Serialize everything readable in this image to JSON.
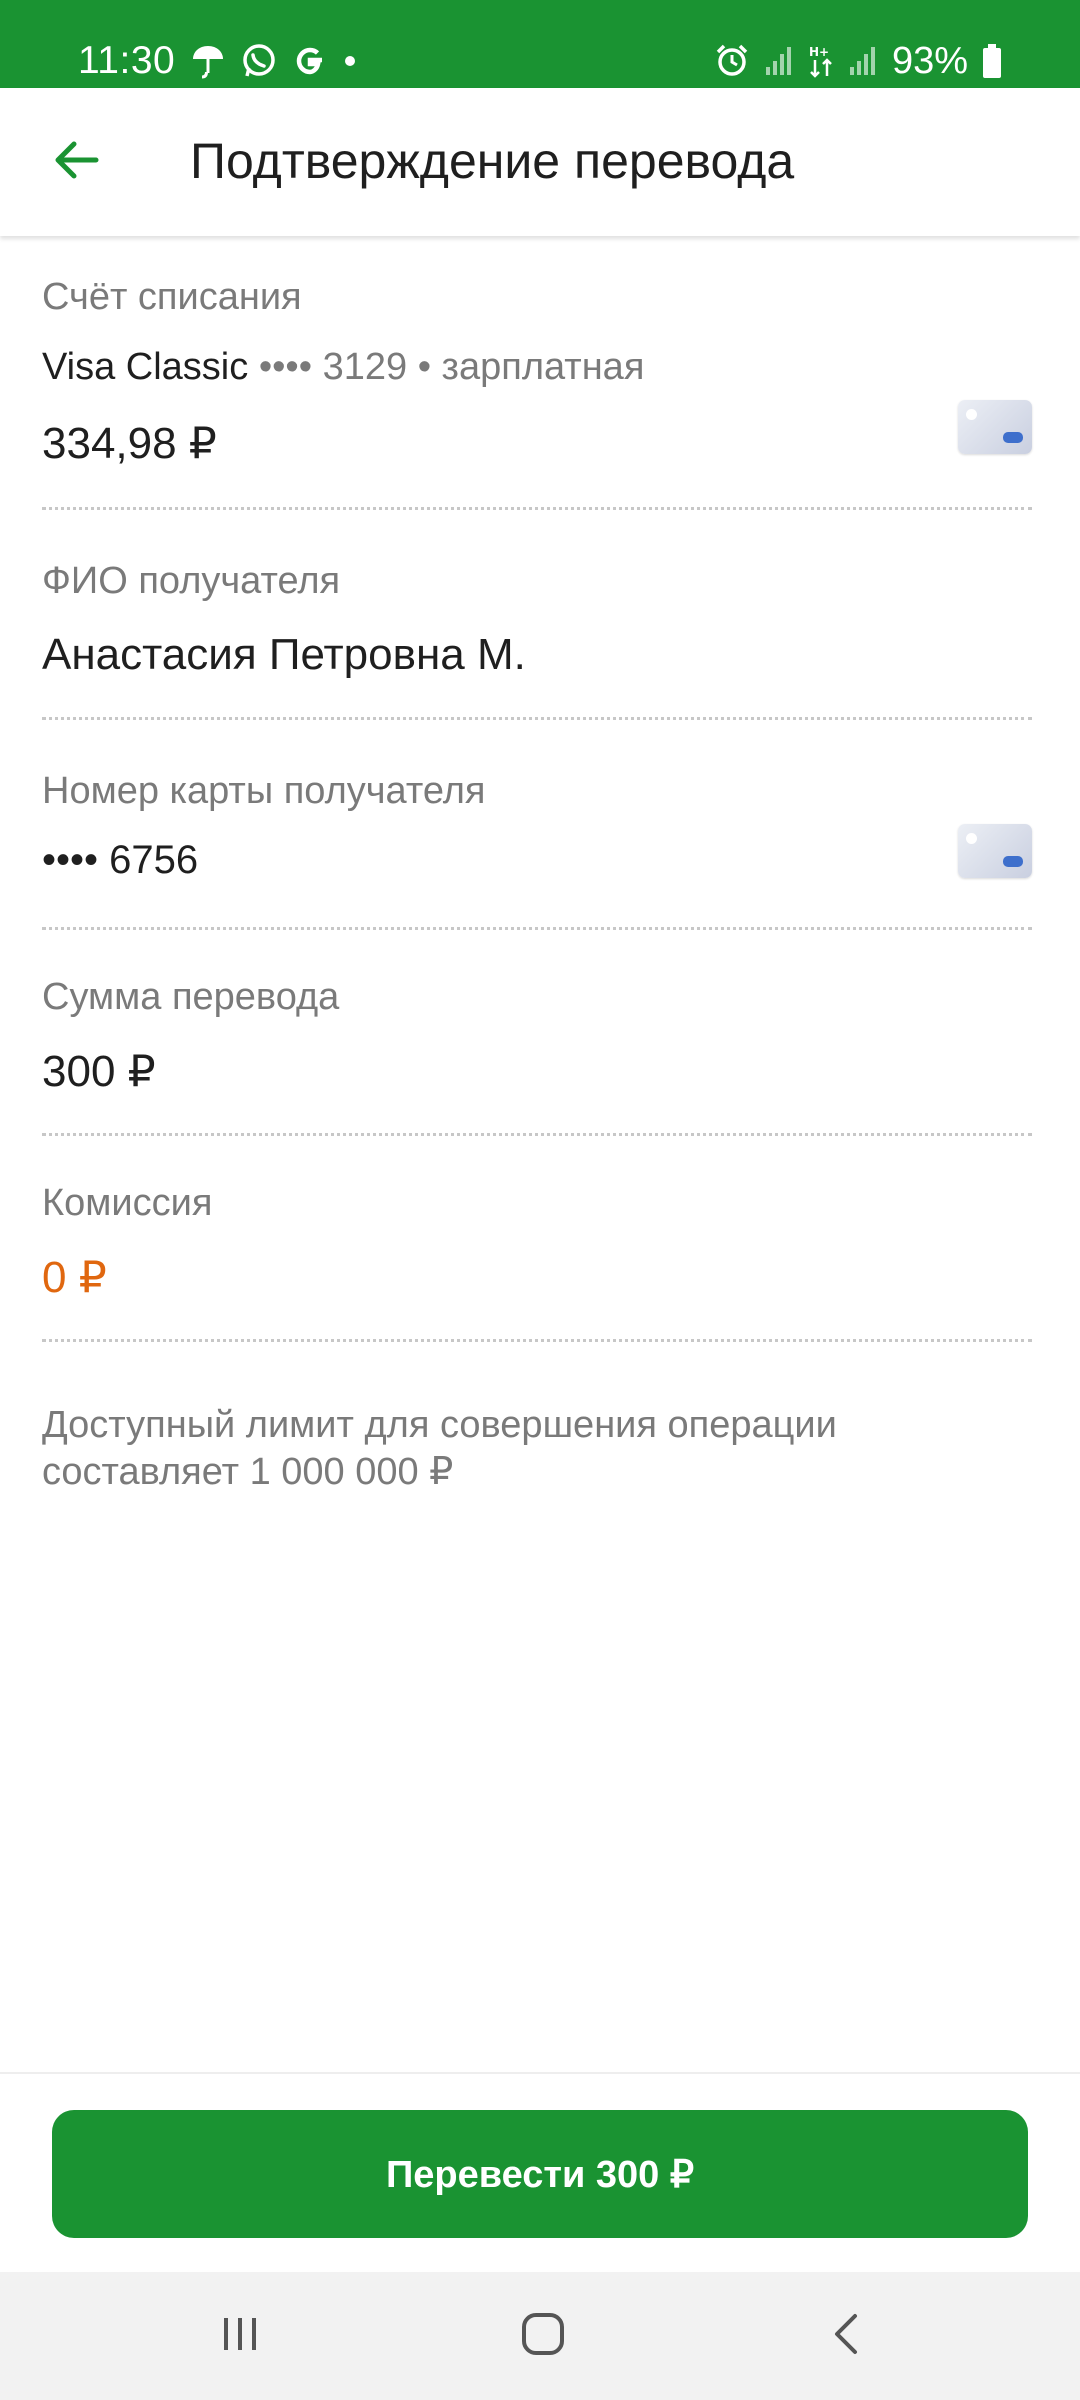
{
  "status_bar": {
    "time": "11:30",
    "battery": "93%",
    "icons_left": [
      "umbrella-icon",
      "whatsapp-icon",
      "google-icon",
      "dot-icon"
    ],
    "icons_right": [
      "alarm-icon",
      "signal-icon",
      "data-transfer-icon",
      "signal-icon",
      "battery-icon"
    ]
  },
  "header": {
    "title": "Подтверждение перевода",
    "back_icon": "arrow-left-icon"
  },
  "fields": {
    "source_account": {
      "label": "Счёт списания",
      "card_name": "Visa Classic",
      "card_details": " •••• 3129 • зарплатная",
      "balance": "334,98 ₽"
    },
    "recipient_name": {
      "label": "ФИО получателя",
      "value": "Анастасия Петровна М."
    },
    "recipient_card": {
      "label": "Номер карты получателя",
      "value": "•••• 6756"
    },
    "amount": {
      "label": "Сумма перевода",
      "value": "300 ₽"
    },
    "commission": {
      "label": "Комиссия",
      "value": "0 ₽"
    }
  },
  "limit_note": "Доступный лимит для совершения операции составляет 1 000 000 ₽",
  "action": {
    "transfer_label": "Перевести 300 ₽"
  },
  "colors": {
    "brand_green": "#1a9332",
    "commission_orange": "#e0670f",
    "label_gray": "#7a7a7a"
  },
  "nav_bar": {
    "icons": [
      "recent-apps-icon",
      "home-icon",
      "back-icon"
    ]
  }
}
